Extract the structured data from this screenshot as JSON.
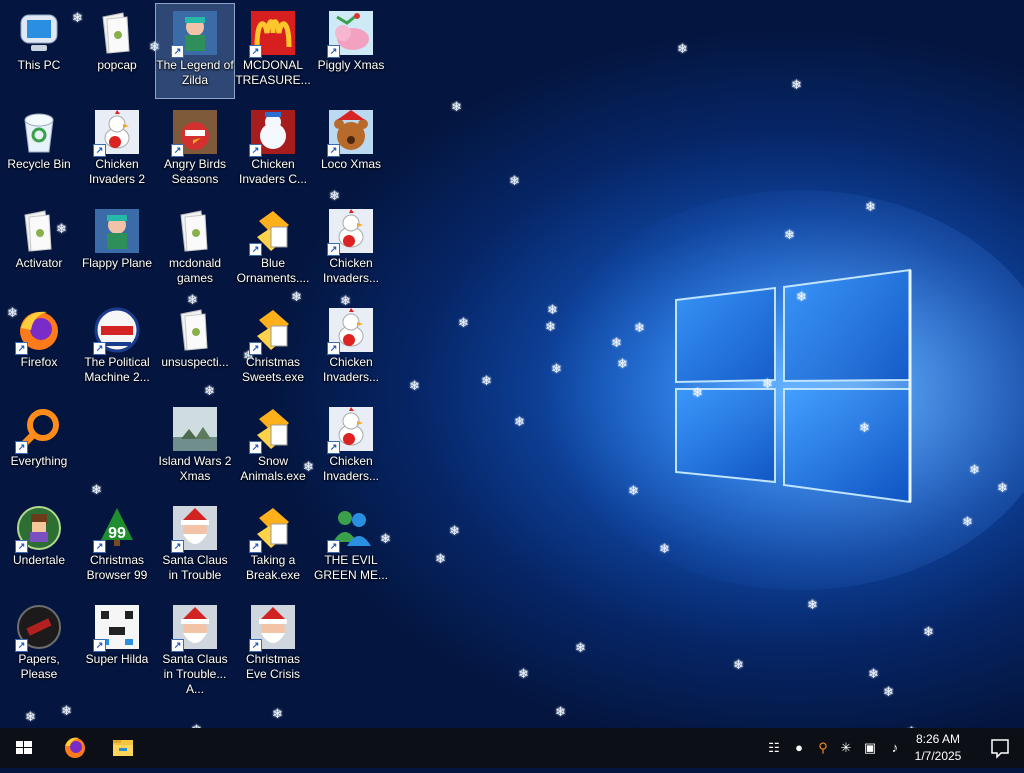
{
  "desktop": {
    "icons": [
      {
        "label": "This PC",
        "icon": "computer-icon"
      },
      {
        "label": "popcap",
        "icon": "folder-icon"
      },
      {
        "label": "The Legend of Zilda",
        "icon": "game-icon",
        "selected": true
      },
      {
        "label": "MCDONAL TREASURE...",
        "icon": "mcdonalds-icon"
      },
      {
        "label": "Piggly Xmas",
        "icon": "pig-icon"
      },
      {
        "label": "Recycle Bin",
        "icon": "recycle-bin-icon"
      },
      {
        "label": "Chicken Invaders 2",
        "icon": "chicken-icon"
      },
      {
        "label": "Angry Birds Seasons",
        "icon": "angry-birds-icon"
      },
      {
        "label": "Chicken Invaders C...",
        "icon": "chicken-snowman-icon"
      },
      {
        "label": "Loco Xmas",
        "icon": "bear-icon"
      },
      {
        "label": "Activator",
        "icon": "folder-icon"
      },
      {
        "label": "Flappy Plane",
        "icon": "game-icon"
      },
      {
        "label": "mcdonald games",
        "icon": "folder-icon"
      },
      {
        "label": "Blue Ornaments....",
        "icon": "exe-icon"
      },
      {
        "label": "Chicken Invaders...",
        "icon": "chicken-icon"
      },
      {
        "label": "Firefox",
        "icon": "firefox-icon"
      },
      {
        "label": "The Political Machine 2...",
        "icon": "political-machine-icon"
      },
      {
        "label": "unsuspecti...",
        "icon": "folder-icon"
      },
      {
        "label": "Christmas Sweets.exe",
        "icon": "exe-icon"
      },
      {
        "label": "Chicken Invaders...",
        "icon": "chicken-icon"
      },
      {
        "label": "Everything",
        "icon": "search-icon"
      },
      {
        "label": "Island Wars 2 Xmas",
        "icon": "island-icon"
      },
      {
        "label": "Snow Animals.exe",
        "icon": "exe-icon"
      },
      {
        "label": "Chicken Invaders...",
        "icon": "chicken-icon"
      },
      {
        "label": "Undertale",
        "icon": "undertale-icon"
      },
      {
        "label": "Christmas Browser 99",
        "icon": "christmas-tree-icon",
        "badge": "99"
      },
      {
        "label": "Santa Claus in Trouble",
        "icon": "santa-icon"
      },
      {
        "label": "Taking a Break.exe",
        "icon": "exe-icon"
      },
      {
        "label": "THE EVIL GREEN ME...",
        "icon": "messenger-icon"
      },
      {
        "label": "Papers, Please",
        "icon": "papers-please-icon"
      },
      {
        "label": "Super Hilda",
        "icon": "pixel-game-icon"
      },
      {
        "label": "Santa Claus in Trouble... A...",
        "icon": "santa-icon"
      },
      {
        "label": "Christmas Eve Crisis",
        "icon": "santa-icon"
      }
    ]
  },
  "taskbar": {
    "start": "windows-start-icon",
    "pinned": [
      {
        "name": "firefox-icon"
      },
      {
        "name": "file-explorer-icon"
      }
    ],
    "tray": [
      "network-printer-icon",
      "drop-icon",
      "search-icon",
      "snowflake-icon",
      "network-icon",
      "volume-muted-icon"
    ],
    "clock": {
      "time": "8:26 AM",
      "date": "1/7/2025"
    },
    "notification": "notification-icon"
  }
}
